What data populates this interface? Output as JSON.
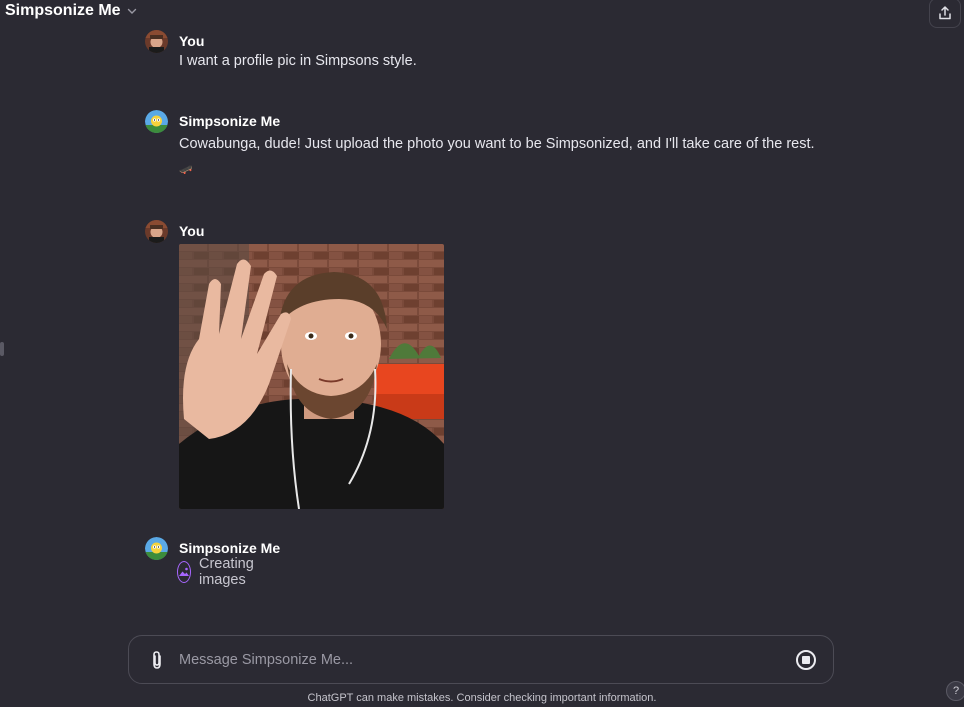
{
  "header": {
    "title": "Simpsonize Me",
    "dropdown_icon": "chevron-down-icon",
    "share_icon": "share-upload-icon"
  },
  "messages": [
    {
      "author": "You",
      "text": "I want a profile pic in Simpsons style."
    },
    {
      "author": "Simpsonize Me",
      "text": "Cowabunga, dude! Just upload the photo you want to be Simpsonized, and I'll take care of the rest.",
      "emoji": "🛹"
    },
    {
      "author": "You",
      "attachment": "photo"
    },
    {
      "author": "Simpsonize Me",
      "status": "Creating images"
    }
  ],
  "composer": {
    "placeholder": "Message Simpsonize Me...",
    "attach_icon": "paperclip-icon",
    "stop_icon": "stop-icon"
  },
  "footer": {
    "disclaimer": "ChatGPT can make mistakes. Consider checking important information.",
    "help": "?"
  },
  "colors": {
    "background": "#2b2a33",
    "text": "#ececf1",
    "accent": "#a766ff"
  }
}
